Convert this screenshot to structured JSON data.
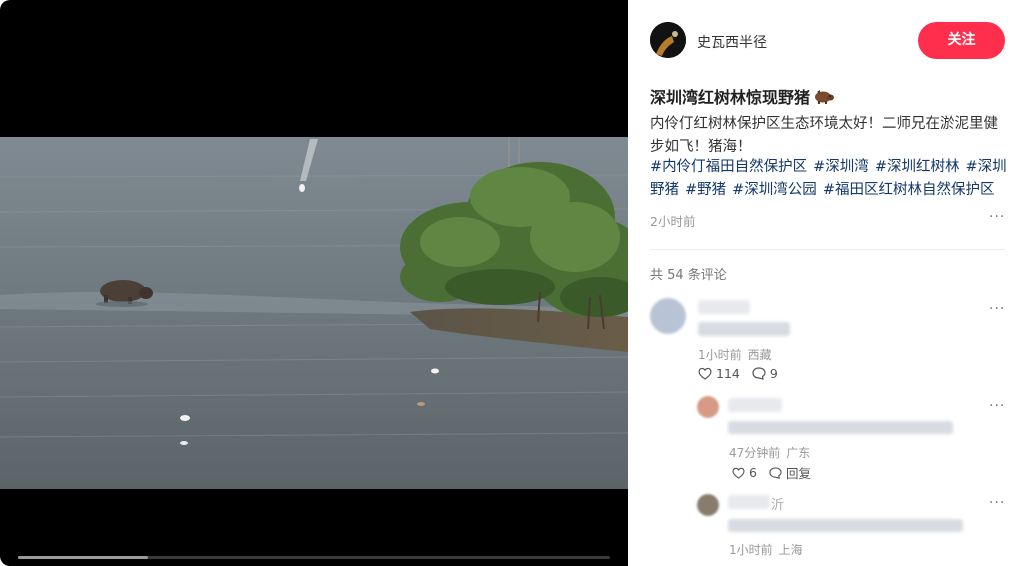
{
  "author": {
    "name": "史瓦西半径",
    "follow_label": "关注"
  },
  "note": {
    "title": "深圳湾红树林惊现野猪",
    "title_icon": "boar-emoji",
    "description": "内伶仃红树林保护区生态环境太好！二师兄在淤泥里健步如飞！猪海！",
    "hashtags": [
      "#内伶仃福田自然保护区",
      "#深圳湾",
      "#深圳红树林",
      "#深圳野猪",
      "#野猪",
      "#深圳湾公园",
      "#福田区红树林自然保护区"
    ],
    "time": "2小时前"
  },
  "video": {
    "progress": 0.22
  },
  "comments_header": "共 54 条评论",
  "comments": [
    {
      "name_tail": "",
      "time": "1小时前",
      "location": "西藏",
      "likes": "114",
      "replies": "9"
    },
    {
      "name_tail": "",
      "time": "47分钟前",
      "location": "广东",
      "likes": "6",
      "reply_label": "回复"
    },
    {
      "name_tail": "沂",
      "time": "1小时前",
      "location": "上海"
    }
  ],
  "colors": {
    "accent": "#ff2e4d",
    "hashtag": "#13386c"
  }
}
